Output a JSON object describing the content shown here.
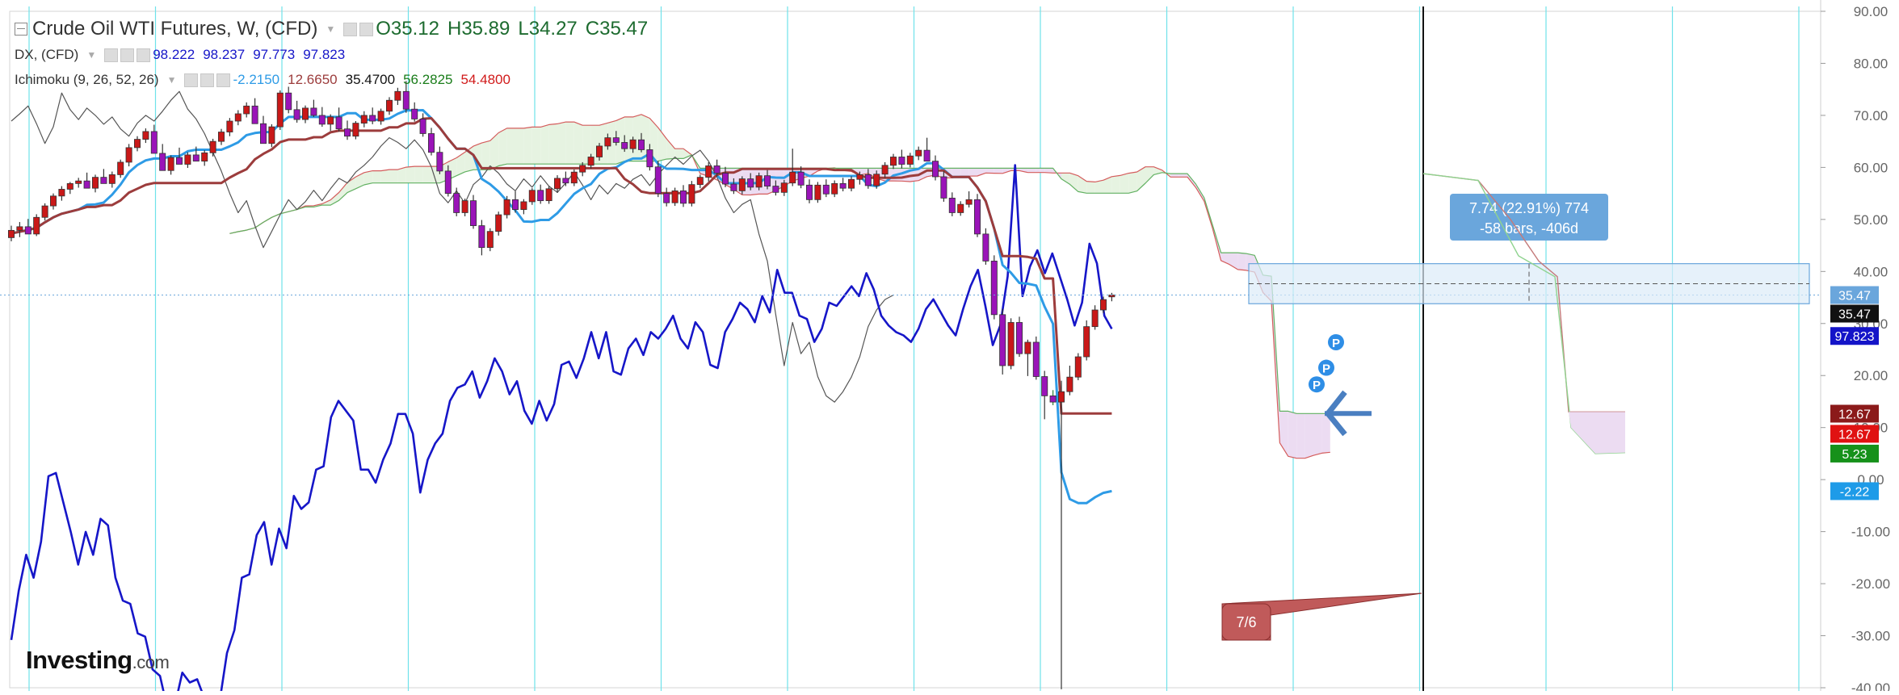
{
  "legend": {
    "main": {
      "title": "Crude Oil WTI Futures, W, (CFD)",
      "open": "O35.12",
      "high": "H35.89",
      "low": "L34.27",
      "close": "C35.47"
    },
    "dx": {
      "name": "DX, (CFD)",
      "v1": "98.222",
      "v2": "98.237",
      "v3": "97.773",
      "v4": "97.823"
    },
    "ichimoku": {
      "name": "Ichimoku (9, 26, 52, 26)",
      "v1": "-2.2150",
      "v2": "12.6650",
      "v3": "35.4700",
      "v4": "56.2825",
      "v5": "54.4800"
    }
  },
  "colors": {
    "bull": "#c91818",
    "bear": "#9a14b8",
    "tenkan": "#2e9be6",
    "kijun": "#9c3c3c",
    "dx": "#1616c8",
    "lagging": "#555555",
    "senkouA": "#d45c5c",
    "senkouB": "#62b162",
    "cloudBull": "#e6f3e1",
    "cloudBear": "#ecdcf2",
    "grid": "#6fe2ea",
    "axisText": "#666666",
    "measure": "#6aa6dc"
  },
  "chart_data": {
    "type": "candlestick",
    "symbol": "Crude Oil WTI Futures",
    "timeframe": "W",
    "ylim": [
      -40,
      90
    ],
    "yticks": [
      -40,
      -30,
      -20,
      -10,
      0,
      10,
      20,
      30,
      40,
      50,
      60,
      70,
      80,
      90
    ],
    "yticklabels": [
      "-40.00",
      "-30.00",
      "-20.00",
      "-10.00",
      "0.00",
      "10.00",
      "20.00",
      "30.00",
      "40.00",
      "50.00",
      "60.00",
      "70.00",
      "80.00",
      "90.00"
    ],
    "candles": [
      [
        46.5,
        48.8,
        45.8,
        47.9
      ],
      [
        47.9,
        49.5,
        46.6,
        48.6
      ],
      [
        48.6,
        50.1,
        47.9,
        47.2
      ],
      [
        47.2,
        51.0,
        46.8,
        50.4
      ],
      [
        50.4,
        53.1,
        49.8,
        52.6
      ],
      [
        52.6,
        55.0,
        51.9,
        54.5
      ],
      [
        54.5,
        56.4,
        53.6,
        55.8
      ],
      [
        55.8,
        57.2,
        54.9,
        56.9
      ],
      [
        56.9,
        58.0,
        56.1,
        57.4
      ],
      [
        57.4,
        59.0,
        56.8,
        56.0
      ],
      [
        56.0,
        58.6,
        55.2,
        58.1
      ],
      [
        58.1,
        59.7,
        57.3,
        56.9
      ],
      [
        56.9,
        59.2,
        56.1,
        58.6
      ],
      [
        58.6,
        61.5,
        58.0,
        61.0
      ],
      [
        61.0,
        64.5,
        60.2,
        63.8
      ],
      [
        63.8,
        66.0,
        63.1,
        65.4
      ],
      [
        65.4,
        67.5,
        64.7,
        66.9
      ],
      [
        66.9,
        68.2,
        65.8,
        62.7
      ],
      [
        62.7,
        64.5,
        61.0,
        59.4
      ],
      [
        59.4,
        62.3,
        58.6,
        61.9
      ],
      [
        61.9,
        63.8,
        61.1,
        60.6
      ],
      [
        60.6,
        62.9,
        59.9,
        62.4
      ],
      [
        62.4,
        64.0,
        61.6,
        61.2
      ],
      [
        61.2,
        63.3,
        60.3,
        62.8
      ],
      [
        62.8,
        65.5,
        62.1,
        65.0
      ],
      [
        65.0,
        67.4,
        64.3,
        66.8
      ],
      [
        66.8,
        69.5,
        66.0,
        68.9
      ],
      [
        68.9,
        71.0,
        68.1,
        70.3
      ],
      [
        70.3,
        72.5,
        69.6,
        71.8
      ],
      [
        71.8,
        73.3,
        70.5,
        68.4
      ],
      [
        68.4,
        69.9,
        66.2,
        64.6
      ],
      [
        64.6,
        68.3,
        63.9,
        67.8
      ],
      [
        67.8,
        74.8,
        67.2,
        74.3
      ],
      [
        74.3,
        75.5,
        70.4,
        71.1
      ],
      [
        71.1,
        72.8,
        68.6,
        69.2
      ],
      [
        69.2,
        71.9,
        68.5,
        71.4
      ],
      [
        71.4,
        73.0,
        69.7,
        70.0
      ],
      [
        70.0,
        71.6,
        67.8,
        68.3
      ],
      [
        68.3,
        70.2,
        67.0,
        69.7
      ],
      [
        69.7,
        71.5,
        66.9,
        67.4
      ],
      [
        67.4,
        69.0,
        65.3,
        66.0
      ],
      [
        66.0,
        68.9,
        65.4,
        68.5
      ],
      [
        68.5,
        70.8,
        67.7,
        70.0
      ],
      [
        70.0,
        71.5,
        68.3,
        68.9
      ],
      [
        68.9,
        71.3,
        68.2,
        70.8
      ],
      [
        70.8,
        73.5,
        70.1,
        72.9
      ],
      [
        72.9,
        75.3,
        72.0,
        74.6
      ],
      [
        74.6,
        76.6,
        70.5,
        71.2
      ],
      [
        71.2,
        72.5,
        68.8,
        69.3
      ],
      [
        69.3,
        70.4,
        65.9,
        66.5
      ],
      [
        66.5,
        67.6,
        62.3,
        62.9
      ],
      [
        62.9,
        64.0,
        58.7,
        59.3
      ],
      [
        59.3,
        60.4,
        54.4,
        55.0
      ],
      [
        55.0,
        56.1,
        50.6,
        51.3
      ],
      [
        51.3,
        54.0,
        50.6,
        53.6
      ],
      [
        53.6,
        54.7,
        48.2,
        48.8
      ],
      [
        48.8,
        49.9,
        43.1,
        44.6
      ],
      [
        44.6,
        48.3,
        43.9,
        47.7
      ],
      [
        47.7,
        51.5,
        46.9,
        50.9
      ],
      [
        50.9,
        54.5,
        50.2,
        53.8
      ],
      [
        53.8,
        55.4,
        51.3,
        51.9
      ],
      [
        51.9,
        53.9,
        51.0,
        53.4
      ],
      [
        53.4,
        56.0,
        52.8,
        55.6
      ],
      [
        55.6,
        56.7,
        53.0,
        53.6
      ],
      [
        53.6,
        56.4,
        53.0,
        55.9
      ],
      [
        55.9,
        58.5,
        55.1,
        57.9
      ],
      [
        57.9,
        59.2,
        56.4,
        57.0
      ],
      [
        57.0,
        59.6,
        56.4,
        59.1
      ],
      [
        59.1,
        61.0,
        58.3,
        60.4
      ],
      [
        60.4,
        62.6,
        59.8,
        62.0
      ],
      [
        62.0,
        64.7,
        61.3,
        64.1
      ],
      [
        64.1,
        66.5,
        63.4,
        65.7
      ],
      [
        65.7,
        67.0,
        64.2,
        64.8
      ],
      [
        64.8,
        66.2,
        63.0,
        63.6
      ],
      [
        63.6,
        65.9,
        62.8,
        65.3
      ],
      [
        65.3,
        66.6,
        62.9,
        63.4
      ],
      [
        63.4,
        64.5,
        59.4,
        60.1
      ],
      [
        60.1,
        61.2,
        54.3,
        55.0
      ],
      [
        55.0,
        56.1,
        52.5,
        53.2
      ],
      [
        53.2,
        56.1,
        52.6,
        55.5
      ],
      [
        55.5,
        56.6,
        52.4,
        53.1
      ],
      [
        53.1,
        57.4,
        52.5,
        56.7
      ],
      [
        56.7,
        58.6,
        56.0,
        58.1
      ],
      [
        58.1,
        61.0,
        57.3,
        60.3
      ],
      [
        60.3,
        61.5,
        58.2,
        58.9
      ],
      [
        58.9,
        60.1,
        56.2,
        56.8
      ],
      [
        56.8,
        57.9,
        54.9,
        55.5
      ],
      [
        55.5,
        58.3,
        54.8,
        57.8
      ],
      [
        57.8,
        58.9,
        55.6,
        56.2
      ],
      [
        56.2,
        59.0,
        55.6,
        58.4
      ],
      [
        58.4,
        59.5,
        55.8,
        56.4
      ],
      [
        56.4,
        57.5,
        54.6,
        55.2
      ],
      [
        55.2,
        57.6,
        54.5,
        57.0
      ],
      [
        57.0,
        63.6,
        56.4,
        59.1
      ],
      [
        59.1,
        60.2,
        56.0,
        56.6
      ],
      [
        56.6,
        57.7,
        53.1,
        53.8
      ],
      [
        53.8,
        57.2,
        53.2,
        56.6
      ],
      [
        56.6,
        57.7,
        54.3,
        54.9
      ],
      [
        54.9,
        57.5,
        54.3,
        56.9
      ],
      [
        56.9,
        58.0,
        55.4,
        56.0
      ],
      [
        56.0,
        58.3,
        55.4,
        57.7
      ],
      [
        57.7,
        59.2,
        56.7,
        58.6
      ],
      [
        58.6,
        59.7,
        55.9,
        56.5
      ],
      [
        56.5,
        59.4,
        55.9,
        58.7
      ],
      [
        58.7,
        61.0,
        58.0,
        60.4
      ],
      [
        60.4,
        62.6,
        59.7,
        62.0
      ],
      [
        62.0,
        63.4,
        59.8,
        60.6
      ],
      [
        60.6,
        62.8,
        60.0,
        62.2
      ],
      [
        62.2,
        64.0,
        61.4,
        63.3
      ],
      [
        63.3,
        65.7,
        62.7,
        61.2
      ],
      [
        61.2,
        62.3,
        57.5,
        58.2
      ],
      [
        58.2,
        59.3,
        53.4,
        54.1
      ],
      [
        54.1,
        55.2,
        50.6,
        51.3
      ],
      [
        51.3,
        53.5,
        50.7,
        52.9
      ],
      [
        52.9,
        55.4,
        52.3,
        53.8
      ],
      [
        53.8,
        54.9,
        46.6,
        47.2
      ],
      [
        47.2,
        48.3,
        41.3,
        42.0
      ],
      [
        42.0,
        43.1,
        30.8,
        31.7
      ],
      [
        31.7,
        32.8,
        20.2,
        21.9
      ],
      [
        21.9,
        31.0,
        21.2,
        30.2
      ],
      [
        30.2,
        31.3,
        23.6,
        24.2
      ],
      [
        24.2,
        26.9,
        19.9,
        26.4
      ],
      [
        26.4,
        27.5,
        19.2,
        19.8
      ],
      [
        19.8,
        20.9,
        11.6,
        16.1
      ],
      [
        16.1,
        17.2,
        14.3,
        14.9
      ],
      [
        14.9,
        19.0,
        -40.3,
        16.9
      ],
      [
        16.9,
        21.9,
        16.2,
        19.7
      ],
      [
        19.7,
        24.3,
        19.1,
        23.6
      ],
      [
        23.6,
        30.6,
        22.9,
        29.4
      ],
      [
        29.4,
        33.5,
        28.8,
        32.6
      ],
      [
        32.6,
        35.2,
        32.0,
        34.6
      ],
      [
        35.12,
        35.89,
        34.27,
        35.47
      ]
    ],
    "dx_index": [
      88.3,
      89.8,
      90.9,
      90.2,
      91.3,
      93.3,
      93.4,
      92.5,
      91.6,
      90.6,
      91.6,
      90.9,
      92.0,
      91.8,
      90.2,
      89.5,
      89.4,
      88.5,
      88.4,
      87.4,
      87.2,
      86.2,
      86.3,
      87.3,
      87.0,
      87.1,
      86.5,
      86.6,
      86.4,
      87.9,
      88.6,
      90.2,
      90.3,
      91.5,
      91.9,
      90.6,
      91.7,
      91.1,
      92.7,
      92.3,
      92.5,
      93.5,
      93.6,
      95.1,
      95.6,
      95.3,
      95.0,
      93.5,
      93.5,
      93.1,
      93.8,
      94.3,
      95.2,
      95.2,
      94.6,
      92.8,
      93.8,
      94.3,
      94.6,
      95.6,
      96.0,
      96.1,
      96.5,
      95.7,
      96.2,
      96.9,
      96.5,
      95.8,
      96.2,
      95.3,
      94.9,
      95.6,
      95.0,
      95.5,
      96.7,
      96.8,
      96.3,
      96.9,
      97.7,
      96.9,
      97.7,
      96.5,
      96.4,
      97.2,
      97.5,
      97.0,
      97.7,
      97.5,
      97.8,
      98.2,
      97.5,
      97.2,
      98.0,
      97.7,
      96.7,
      96.6,
      97.7,
      98.1,
      98.6,
      98.4,
      98.0,
      98.8,
      98.3,
      99.6,
      98.9,
      98.9,
      98.2,
      98.1,
      97.4,
      97.8,
      98.6,
      98.5,
      98.8,
      99.1,
      98.8,
      99.5,
      99.0,
      98.2,
      97.9,
      97.7,
      97.6,
      97.4,
      97.8,
      98.4,
      98.7,
      98.3,
      97.9,
      97.6,
      98.4,
      99.1,
      99.6,
      98.5,
      97.3,
      97.9,
      99.4,
      102.8,
      98.8,
      99.7,
      100.2,
      99.5,
      100.1,
      99.4,
      98.7,
      97.9,
      98.6,
      100.4,
      99.8,
      98.2,
      97.8
    ],
    "dx_scale": {
      "min": 88,
      "max": 102.3,
      "ylim": [
        -40,
        90
      ],
      "range_mapped_to": [
        -32.7,
        57.3
      ]
    },
    "ichimoku": {
      "tenkan_last": -2.215,
      "kijun_last": 12.665,
      "lagging_last": 35.47,
      "senkouA_last": 56.2825,
      "senkouB_last": 54.48
    },
    "measure": {
      "label": "7.74 (22.91%) 774",
      "label2": "-58 bars, -406d",
      "from": 33.8,
      "to": 41.5
    },
    "annotation": {
      "label": "7/6"
    },
    "axis_badges": [
      {
        "text": "35.47",
        "value": 35.47,
        "bg": "#6aa6dc",
        "fg": "#ffffff"
      },
      {
        "text": "35.47",
        "value": 31.9,
        "bg": "#111111",
        "fg": "#ffffff"
      },
      {
        "text": "97.823",
        "value": 27.6,
        "bg": "#1414c8",
        "fg": "#ffffff"
      },
      {
        "text": "12.67",
        "value": 12.67,
        "bg": "#8b1a1a",
        "fg": "#ffffff"
      },
      {
        "text": "12.67",
        "value": 8.8,
        "bg": "#e01212",
        "fg": "#ffffff"
      },
      {
        "text": "5.23",
        "value": 5.0,
        "bg": "#16911a",
        "fg": "#ffffff"
      },
      {
        "text": "-2.22",
        "value": -2.22,
        "bg": "#1e9be8",
        "fg": "#ffffff"
      }
    ],
    "pivot_markers": [
      "P",
      "P",
      "P"
    ]
  },
  "branding": {
    "logo_main": "Investing",
    "logo_suffix": ".com"
  }
}
